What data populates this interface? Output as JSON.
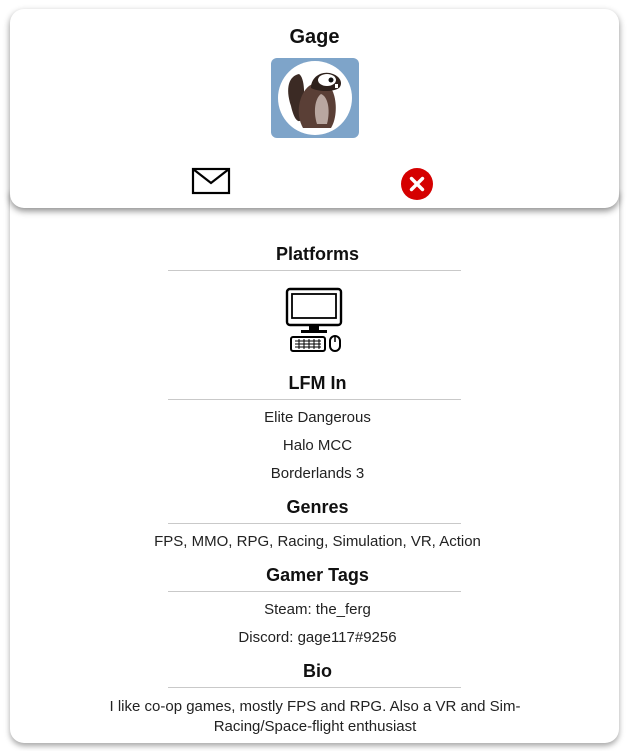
{
  "profile": {
    "name": "Gage",
    "avatar_icon": "beaver-avatar-icon",
    "avatar_bg": "#7ea4c9",
    "actions": {
      "message_icon": "envelope-icon",
      "close_icon": "close-circle-icon",
      "close_color": "#d50000"
    }
  },
  "sections": {
    "platforms": {
      "title": "Platforms",
      "items": [
        "pc-icon"
      ]
    },
    "lfm": {
      "title": "LFM In",
      "items": [
        "Elite Dangerous",
        "Halo MCC",
        "Borderlands 3"
      ]
    },
    "genres": {
      "title": "Genres",
      "text": "FPS, MMO, RPG, Racing, Simulation, VR, Action"
    },
    "gamer_tags": {
      "title": "Gamer Tags",
      "items": [
        "Steam: the_ferg",
        "Discord: gage117#9256"
      ]
    },
    "bio": {
      "title": "Bio",
      "text": "I like co-op games, mostly FPS and RPG. Also a VR and Sim-Racing/Space-flight enthusiast"
    }
  }
}
